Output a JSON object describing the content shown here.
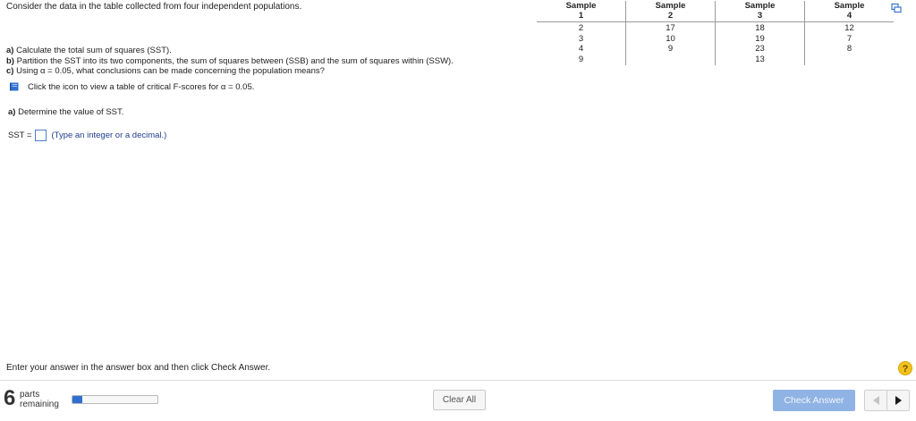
{
  "problem": {
    "intro": "Consider the data in the table collected from four independent populations.",
    "table": {
      "headers": [
        {
          "line1": "Sample",
          "line2": "1"
        },
        {
          "line1": "Sample",
          "line2": "2"
        },
        {
          "line1": "Sample",
          "line2": "3"
        },
        {
          "line1": "Sample",
          "line2": "4"
        }
      ],
      "rows": [
        [
          "2",
          "17",
          "18",
          "12"
        ],
        [
          "3",
          "10",
          "19",
          "7"
        ],
        [
          "4",
          "9",
          "23",
          "8"
        ],
        [
          "9",
          "",
          "13",
          ""
        ]
      ]
    },
    "copy_icon": "copy-data-icon",
    "questions": [
      {
        "label": "a)",
        "text": "Calculate the total sum of squares (SST)."
      },
      {
        "label": "b)",
        "text": "Partition the SST into its two components, the sum of squares between (SSB) and the sum of squares within (SSW)."
      },
      {
        "label": "c)",
        "text": "Using α = 0.05, what conclusions can be made concerning the population means?"
      }
    ],
    "hint": {
      "icon": "book-icon",
      "text": "Click the icon to view a table of critical F-scores for α = 0.05."
    }
  },
  "part_a": {
    "label": "a)",
    "text": "Determine the value of SST.",
    "input_label": "SST =",
    "input_value": "",
    "answer_hint": "(Type an integer or a decimal.)"
  },
  "footer": {
    "instruction": "Enter your answer in the answer box and then click Check Answer.",
    "help_icon": "?",
    "parts_count": "6",
    "parts_line1": "parts",
    "parts_line2": "remaining",
    "progress_fraction": 0.12,
    "clear_all_label": "Clear All",
    "check_answer_label": "Check Answer",
    "accent_color": "#2f6fcf",
    "check_answer_color": "#8fb3e4"
  }
}
